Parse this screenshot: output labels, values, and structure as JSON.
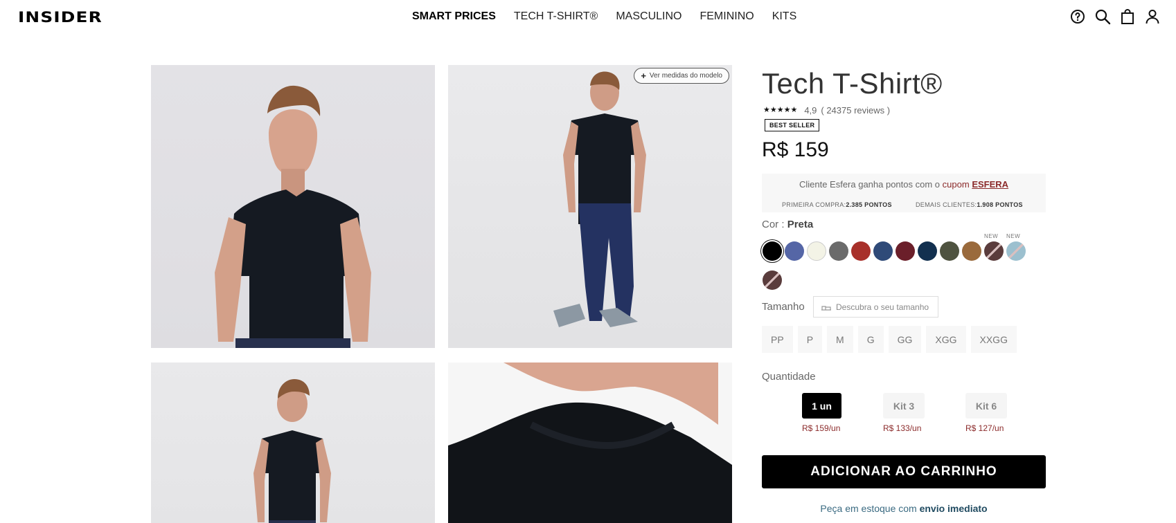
{
  "header": {
    "logo": "INSIDER",
    "nav": [
      "SMART PRICES",
      "TECH T-SHIRT®",
      "MASCULINO",
      "FEMININO",
      "KITS"
    ],
    "icons": [
      "help-icon",
      "search-icon",
      "bag-icon",
      "user-icon"
    ]
  },
  "gallery": {
    "model_measures_label": "Ver medidas do modelo",
    "images": [
      "front-view-photo",
      "full-body-photo",
      "back-view-photo",
      "collar-detail-photo"
    ]
  },
  "product": {
    "title": "Tech T-Shirt®",
    "stars": "★★★★★",
    "rating": "4,9",
    "reviews": "( 24375 reviews )",
    "badge": "BEST SELLER",
    "price": "R$ 159"
  },
  "esfera": {
    "text_prefix": "Cliente Esfera ganha pontos com o",
    "cupom_word": "cupom",
    "code": "ESFERA",
    "first_label": "PRIMEIRA COMPRA:",
    "first_value": "2.385 PONTOS",
    "other_label": "DEMAIS CLIENTES:",
    "other_value": "1.908 PONTOS"
  },
  "color": {
    "label": "Cor :",
    "selected": "Preta",
    "new_tag": "NEW",
    "swatches": [
      "#000000",
      "#5566a6",
      "#f3f3e6",
      "#6b6b6b",
      "#a8302a",
      "#2f4a78",
      "#6b1f2a",
      "#12304f",
      "#4f5340",
      "#9a6a3c",
      "#5a3c3c",
      "#9cc0cf",
      "#5a3c3c"
    ]
  },
  "size": {
    "label": "Tamanho",
    "guide": "Descubra o seu tamanho",
    "options": [
      "PP",
      "P",
      "M",
      "G",
      "GG",
      "XGG",
      "XXGG"
    ]
  },
  "quantity": {
    "label": "Quantidade",
    "options": [
      {
        "label": "1 un",
        "price": "R$ 159/un"
      },
      {
        "label": "Kit 3",
        "price": "R$ 133/un"
      },
      {
        "label": "Kit 6",
        "price": "R$ 127/un"
      }
    ]
  },
  "cart": {
    "button": "ADICIONAR AO CARRINHO",
    "stock_prefix": "Peça em estoque com",
    "stock_strong": "envio imediato"
  }
}
